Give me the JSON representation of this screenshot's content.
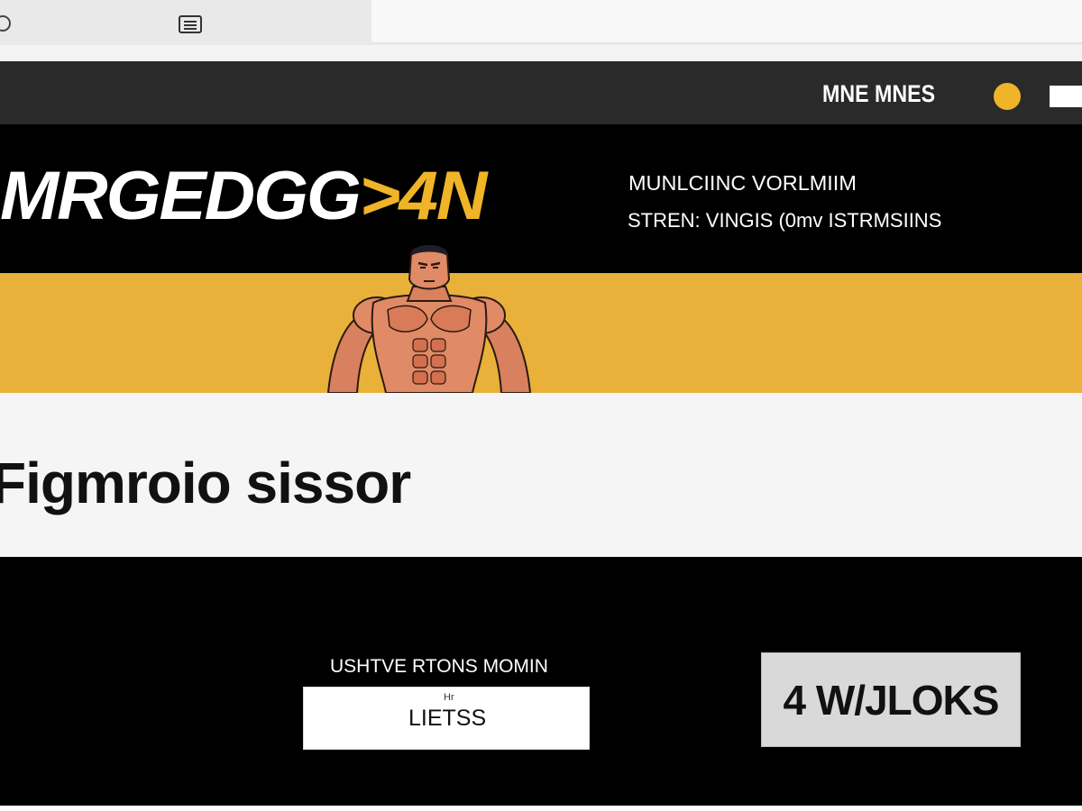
{
  "browser": {
    "icons": [
      "refresh-icon",
      "reader-icon"
    ]
  },
  "nav": {
    "menu_label": "MNE MNES",
    "accent_color": "#f0b429"
  },
  "hero": {
    "logo_main": "MRGEDGG",
    "logo_accent": ">4N",
    "tagline_line1": "MUNLCIINC VORLMIIM",
    "tagline_line2": "STREN: VINGIS (0mv ISTRMSIINS",
    "accent_color": "#e9b03a",
    "mascot_icon": "muscle-mascot-icon"
  },
  "band": {
    "title": "Figmroio sissor"
  },
  "footer": {
    "label": "USHTVE RTONS MOMIN",
    "input_hint": "Hr",
    "input_value": "LIETSS",
    "button_label": "4 W/JLOKS"
  }
}
